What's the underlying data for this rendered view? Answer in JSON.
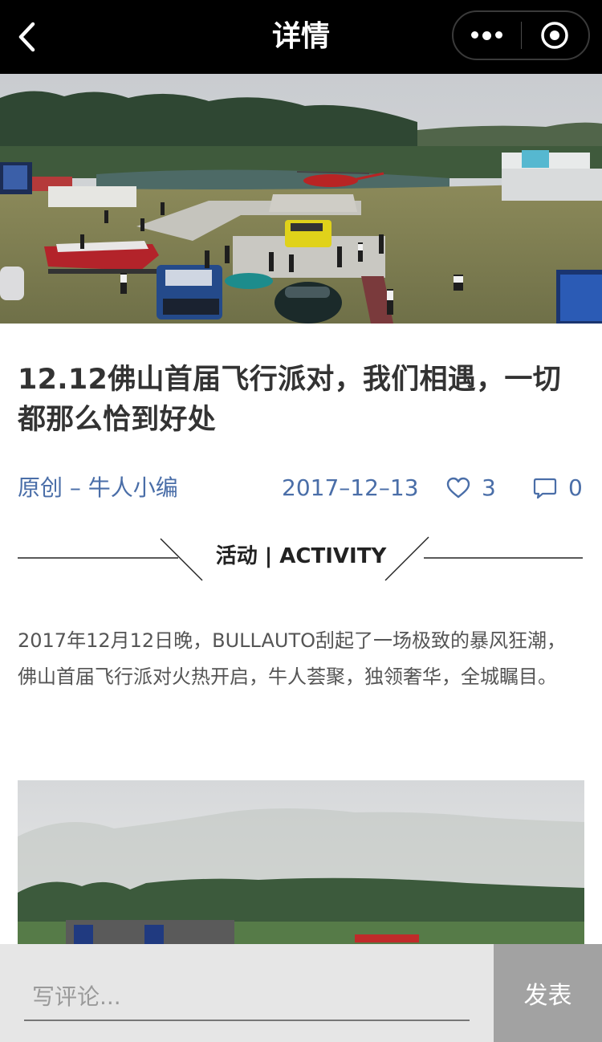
{
  "nav": {
    "title": "详情",
    "back_icon": "chevron-left-icon",
    "more_icon": "more-dots-icon",
    "close_icon": "target-circle-icon"
  },
  "article": {
    "title": "12.12佛山首届飞行派对，我们相遇，一切都那么恰到好处",
    "author": "原创 – 牛人小编",
    "date": "2017–12–13",
    "likes": "3",
    "comments": "0",
    "section_label": "活动 | ACTIVITY",
    "body": "2017年12月12日晚，BULLAUTO刮起了一场极致的暴风狂潮，佛山首届飞行派对火热开启，牛人荟聚，独领奢华，全城瞩目。"
  },
  "comment_bar": {
    "placeholder": "写评论...",
    "submit_label": "发表"
  },
  "colors": {
    "accent": "#4a6ea8",
    "nav_bg": "#000000",
    "submit_bg": "#a2a2a2"
  }
}
